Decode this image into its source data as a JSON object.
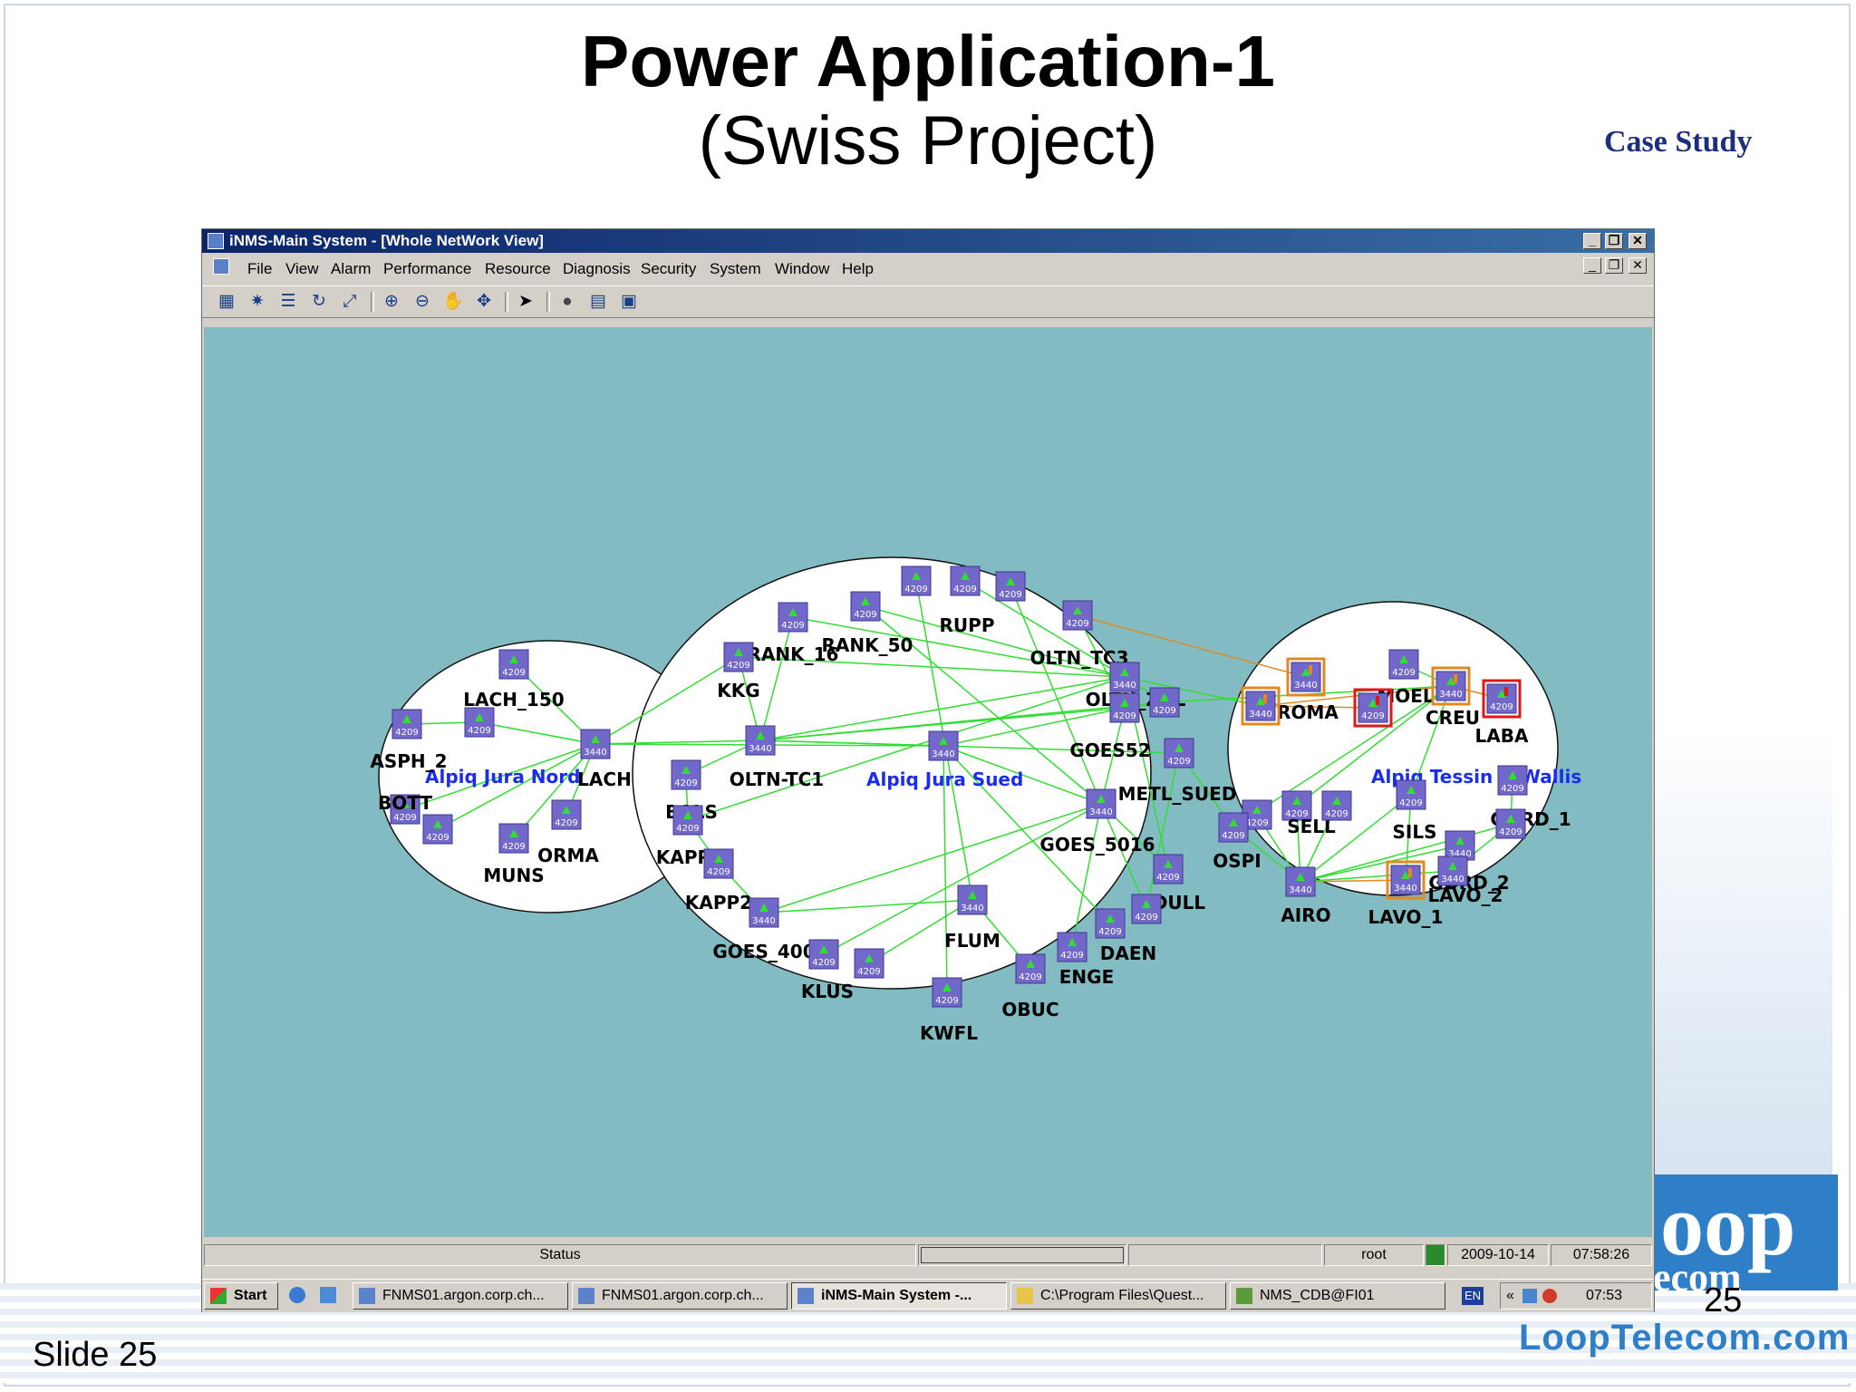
{
  "slide": {
    "title": "Power Application-1",
    "subtitle": "(Swiss Project)",
    "case_study": "Case Study",
    "slide_label": "Slide 25",
    "page_number": "25",
    "brand_url": "LoopTelecom.com",
    "brand_color": "#2f7fc8"
  },
  "window": {
    "title": "iNMS-Main System - [Whole NetWork View]",
    "menu": [
      "File",
      "View",
      "Alarm",
      "Performance",
      "Resource",
      "Diagnosis",
      "Security",
      "System",
      "Window",
      "Help"
    ],
    "toolbar_icons": [
      "topology-icon",
      "network-icon",
      "tree-icon",
      "refresh-icon",
      "fit-icon",
      "zoom-in-icon",
      "zoom-out-icon",
      "pan-hand-icon",
      "move-icon",
      "pointer-icon",
      "globe-icon",
      "list-icon",
      "properties-icon"
    ]
  },
  "network": {
    "background": "#82bcc2",
    "link_color": "#33dd33",
    "alarm_link_color": "#e08a20",
    "node_color": "#7268c9",
    "groups": [
      {
        "id": "g1",
        "label": "Alpiq Jura Nord"
      },
      {
        "id": "g2",
        "label": "Alpiq Jura Sued"
      },
      {
        "id": "g3",
        "label": "Alpiq Tessin + Wallis"
      }
    ],
    "nodes": [
      {
        "id": "LACH_150",
        "label": "LACH_150",
        "model": "4209",
        "status": "normal"
      },
      {
        "id": "ASPH_2",
        "label": "ASPH_2",
        "model": "4209",
        "status": "normal"
      },
      {
        "id": "ASPH_2b",
        "label": "",
        "model": "4209",
        "status": "normal"
      },
      {
        "id": "LACH",
        "label": "LACH",
        "model": "3440",
        "status": "normal"
      },
      {
        "id": "BOTT",
        "label": "BOTT",
        "model": "4209",
        "status": "normal"
      },
      {
        "id": "BOTTb",
        "label": "",
        "model": "4209",
        "status": "normal"
      },
      {
        "id": "MUNS",
        "label": "MUNS",
        "model": "4209",
        "status": "normal"
      },
      {
        "id": "ORMA",
        "label": "ORMA",
        "model": "4209",
        "status": "normal"
      },
      {
        "id": "RANK_50",
        "label": "RANK_50",
        "model": "4209",
        "status": "normal"
      },
      {
        "id": "n_top1",
        "label": "",
        "model": "4209",
        "status": "normal"
      },
      {
        "id": "RUPP",
        "label": "RUPP",
        "model": "4209",
        "status": "normal"
      },
      {
        "id": "n_top2",
        "label": "",
        "model": "4209",
        "status": "normal"
      },
      {
        "id": "OLTN_TC3",
        "label": "OLTN_TC3",
        "model": "4209",
        "status": "normal"
      },
      {
        "id": "RANK_16",
        "label": "RANK_16",
        "model": "4209",
        "status": "normal"
      },
      {
        "id": "KKG",
        "label": "KKG",
        "model": "4209",
        "status": "normal"
      },
      {
        "id": "OLTN_ZNL",
        "label": "OLTN_ZNL",
        "model": "3440",
        "status": "normal"
      },
      {
        "id": "OLTN_ZNLb",
        "label": "",
        "model": "4209",
        "status": "normal"
      },
      {
        "id": "GOES52",
        "label": "GOES52",
        "model": "4209",
        "status": "normal"
      },
      {
        "id": "OLTN_TC1",
        "label": "OLTN-TC1",
        "model": "3440",
        "status": "normal"
      },
      {
        "id": "SUED_HUB",
        "label": "",
        "model": "3440",
        "status": "normal"
      },
      {
        "id": "METL_SUED",
        "label": "METL_SUED",
        "model": "4209",
        "status": "normal"
      },
      {
        "id": "BALS",
        "label": "BALS",
        "model": "4209",
        "status": "normal"
      },
      {
        "id": "KAPP1",
        "label": "KAPP1",
        "model": "4209",
        "status": "normal"
      },
      {
        "id": "KAPP2",
        "label": "KAPP2",
        "model": "4209",
        "status": "normal"
      },
      {
        "id": "GOES_5016",
        "label": "GOES_5016",
        "model": "3440",
        "status": "normal"
      },
      {
        "id": "DULL",
        "label": "DULL",
        "model": "4209",
        "status": "normal"
      },
      {
        "id": "DAEN",
        "label": "DAEN",
        "model": "4209",
        "status": "normal"
      },
      {
        "id": "DAENb",
        "label": "",
        "model": "4209",
        "status": "normal"
      },
      {
        "id": "ENGE",
        "label": "ENGE",
        "model": "4209",
        "status": "normal"
      },
      {
        "id": "GOES_400",
        "label": "GOES_400",
        "model": "3440",
        "status": "normal"
      },
      {
        "id": "FLUM",
        "label": "FLUM",
        "model": "3440",
        "status": "normal"
      },
      {
        "id": "KLUS",
        "label": "KLUS",
        "model": "4209",
        "status": "normal"
      },
      {
        "id": "KLUSb",
        "label": "",
        "model": "4209",
        "status": "normal"
      },
      {
        "id": "KWFL",
        "label": "KWFL",
        "model": "4209",
        "status": "normal"
      },
      {
        "id": "OBUC",
        "label": "OBUC",
        "model": "4209",
        "status": "normal"
      },
      {
        "id": "ROMA",
        "label": "ROMA",
        "model": "3440",
        "status": "minor"
      },
      {
        "id": "MOEL",
        "label": "MOEL",
        "model": "4209",
        "status": "normal"
      },
      {
        "id": "CREU",
        "label": "CREU",
        "model": "3440",
        "status": "minor"
      },
      {
        "id": "LABA",
        "label": "LABA",
        "model": "4209",
        "status": "critical"
      },
      {
        "id": "TW_a",
        "label": "",
        "model": "3440",
        "status": "minor"
      },
      {
        "id": "TW_b",
        "label": "",
        "model": "4209",
        "status": "critical"
      },
      {
        "id": "GORD_1",
        "label": "GORD_1",
        "model": "4209",
        "status": "normal"
      },
      {
        "id": "GORD_1b",
        "label": "",
        "model": "4209",
        "status": "normal"
      },
      {
        "id": "GORD_2",
        "label": "GORD_2",
        "model": "3440",
        "status": "normal"
      },
      {
        "id": "SELL",
        "label": "SELL",
        "model": "4209",
        "status": "normal"
      },
      {
        "id": "SELLb",
        "label": "",
        "model": "4209",
        "status": "normal"
      },
      {
        "id": "SELLc",
        "label": "",
        "model": "4209",
        "status": "normal"
      },
      {
        "id": "SILS",
        "label": "SILS",
        "model": "4209",
        "status": "normal"
      },
      {
        "id": "OSPI",
        "label": "OSPI",
        "model": "4209",
        "status": "normal"
      },
      {
        "id": "AIRO",
        "label": "AIRO",
        "model": "3440",
        "status": "normal"
      },
      {
        "id": "LAVO_1",
        "label": "LAVO_1",
        "model": "3440",
        "status": "minor"
      },
      {
        "id": "LAVO_2",
        "label": "LAVO_2",
        "model": "3440",
        "status": "normal"
      }
    ],
    "links": [
      [
        "LACH_150",
        "LACH"
      ],
      [
        "ASPH_2",
        "ASPH_2b"
      ],
      [
        "ASPH_2b",
        "LACH"
      ],
      [
        "BOTT",
        "LACH"
      ],
      [
        "BOTTb",
        "LACH"
      ],
      [
        "MUNS",
        "LACH"
      ],
      [
        "ORMA",
        "LACH"
      ],
      [
        "LACH",
        "OLTN_TC1"
      ],
      [
        "LACH",
        "KKG"
      ],
      [
        "LACH",
        "SUED_HUB"
      ],
      [
        "OLTN_TC1",
        "KKG"
      ],
      [
        "OLTN_TC1",
        "OLTN_ZNL"
      ],
      [
        "OLTN_TC1",
        "GOES52"
      ],
      [
        "OLTN_TC1",
        "OLTN_ZNLb"
      ],
      [
        "OLTN_TC1",
        "SUED_HUB"
      ],
      [
        "OLTN_TC1",
        "METL_SUED"
      ],
      [
        "OLTN_TC1",
        "BALS"
      ],
      [
        "OLTN_TC1",
        "RANK_16"
      ],
      [
        "RANK_16",
        "OLTN_ZNL"
      ],
      [
        "RANK_50",
        "GOES_5016"
      ],
      [
        "n_top1",
        "FLUM"
      ],
      [
        "RUPP",
        "OLTN_ZNL"
      ],
      [
        "n_top2",
        "GOES_5016"
      ],
      [
        "OLTN_TC3",
        "GOES52"
      ],
      [
        "KKG",
        "OLTN_ZNL"
      ],
      [
        "GOES52",
        "SUED_HUB"
      ],
      [
        "OLTN_ZNL",
        "DULL"
      ],
      [
        "OLTN_ZNL",
        "OLTN_ZNLb"
      ],
      [
        "RANK_50",
        "OLTN_ZNL"
      ],
      [
        "GOES52",
        "GOES_5016"
      ],
      [
        "SUED_HUB",
        "GOES_5016"
      ],
      [
        "SUED_HUB",
        "KWFL"
      ],
      [
        "SUED_HUB",
        "DAEN"
      ],
      [
        "GOES_5016",
        "GOES_400"
      ],
      [
        "GOES_5016",
        "KLUS"
      ],
      [
        "GOES_5016",
        "ENGE"
      ],
      [
        "GOES_5016",
        "DULL"
      ],
      [
        "FLUM",
        "GOES_400"
      ],
      [
        "FLUM",
        "OBUC"
      ],
      [
        "FLUM",
        "KLUSb"
      ],
      [
        "KAPP1",
        "KAPP2"
      ],
      [
        "KAPP1",
        "OLTN_ZNL"
      ],
      [
        "KAPP2",
        "GOES_400"
      ],
      [
        "BALS",
        "KAPP1"
      ],
      [
        "METL_SUED",
        "DAENb"
      ],
      [
        "GOES_5016",
        "DAENb"
      ],
      [
        "OLTN_ZNLb",
        "GOES52"
      ],
      [
        "OLTN_ZNL",
        "TW_a"
      ],
      [
        "OLTN_ZNLb",
        "CREU"
      ],
      [
        "CREU",
        "SILS"
      ],
      [
        "CREU",
        "SELL"
      ],
      [
        "CREU",
        "OSPI"
      ],
      [
        "MOEL",
        "CREU"
      ],
      [
        "SELL",
        "AIRO"
      ],
      [
        "SELLb",
        "AIRO"
      ],
      [
        "SELLc",
        "AIRO"
      ],
      [
        "OSPI",
        "AIRO"
      ],
      [
        "SILS",
        "AIRO"
      ],
      [
        "GORD_2",
        "AIRO"
      ],
      [
        "GORD_1",
        "GORD_1b"
      ],
      [
        "GORD_1b",
        "AIRO"
      ],
      [
        "LAVO_2",
        "AIRO"
      ],
      [
        "GORD_1b",
        "LAVO_2"
      ],
      [
        "SILS",
        "LAVO_1"
      ],
      [
        "METL_SUED",
        "OSPI"
      ]
    ],
    "alarm_links": [
      [
        "OLTN_TC3",
        "ROMA"
      ],
      [
        "TW_a",
        "TW_b"
      ],
      [
        "CREU",
        "LABA"
      ],
      [
        "CREU",
        "TW_a"
      ],
      [
        "AIRO",
        "LAVO_1"
      ]
    ]
  },
  "status": {
    "label": "Status",
    "user": "root",
    "date": "2009-10-14",
    "time": "07:58:26"
  },
  "taskbar": {
    "start_label": "Start",
    "tasks": [
      {
        "label": "FNMS01.argon.corp.ch...",
        "active": false
      },
      {
        "label": "FNMS01.argon.corp.ch...",
        "active": false
      },
      {
        "label": "iNMS-Main System -...",
        "active": true
      },
      {
        "label": "C:\\Program Files\\Quest...",
        "active": false
      },
      {
        "label": "NMS_CDB@FI01",
        "active": false
      }
    ],
    "lang": "EN",
    "clock": "07:53"
  }
}
